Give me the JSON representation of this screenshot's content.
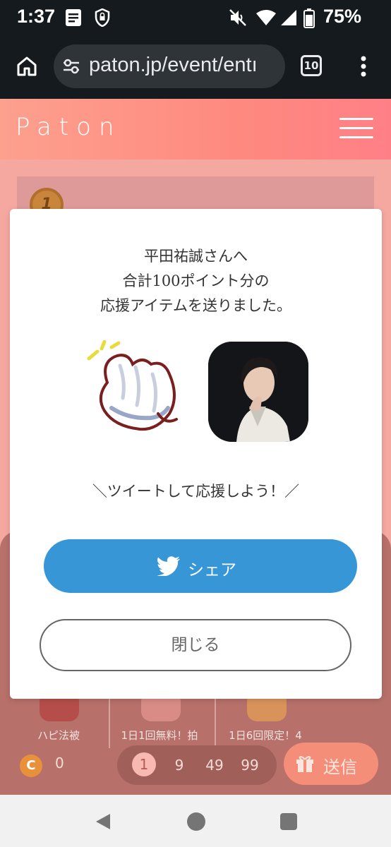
{
  "status_bar": {
    "time": "1:37",
    "battery": "75%",
    "icons": [
      "document-icon",
      "shield-lock-icon",
      "mute-icon",
      "wifi-icon",
      "signal-icon",
      "battery-icon"
    ]
  },
  "browser": {
    "url": "paton.jp/event/entı",
    "tab_count": "10"
  },
  "site": {
    "logo": "Paton",
    "accent_color": "#fe8a7f"
  },
  "modal": {
    "message_line1": "平田祐誠さんへ",
    "message_line2": "合計100ポイント分の",
    "message_line3": "応援アイテムを送りました。",
    "cta": "＼ツイートして応援しよう！／",
    "share_label": "シェア",
    "close_label": "閉じる",
    "share_color": "#3696d6"
  },
  "background": {
    "rank_badge": "1",
    "gifts": [
      {
        "label": "ハピ法被"
      },
      {
        "label": "1日1回無料！拍"
      },
      {
        "label": "1日6回限定！4"
      }
    ],
    "coin_icon": "C",
    "coin_count": "0",
    "amount_options": [
      "1",
      "9",
      "49",
      "99"
    ],
    "selected_amount": "1",
    "send_label": "送信"
  }
}
